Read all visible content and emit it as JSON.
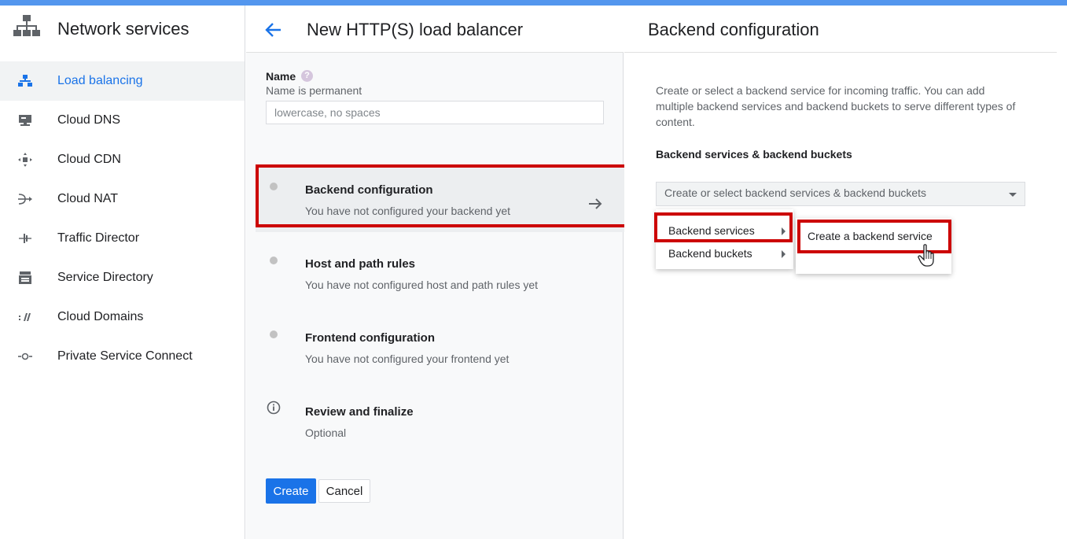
{
  "sidebar": {
    "title": "Network services",
    "items": [
      {
        "label": "Load balancing",
        "icon": "load-balancing-icon",
        "active": true
      },
      {
        "label": "Cloud DNS",
        "icon": "dns-icon"
      },
      {
        "label": "Cloud CDN",
        "icon": "cdn-icon"
      },
      {
        "label": "Cloud NAT",
        "icon": "nat-icon"
      },
      {
        "label": "Traffic Director",
        "icon": "traffic-director-icon"
      },
      {
        "label": "Service Directory",
        "icon": "service-directory-icon"
      },
      {
        "label": "Cloud Domains",
        "icon": "domains-icon"
      },
      {
        "label": "Private Service Connect",
        "icon": "private-service-connect-icon"
      }
    ]
  },
  "middle": {
    "title": "New HTTP(S) load balancer",
    "name_label": "Name",
    "name_hint": "Name is permanent",
    "name_placeholder": "lowercase, no spaces",
    "steps": [
      {
        "title": "Backend configuration",
        "subtitle": "You have not configured your backend yet"
      },
      {
        "title": "Host and path rules",
        "subtitle": "You have not configured host and path rules yet"
      },
      {
        "title": "Frontend configuration",
        "subtitle": "You have not configured your frontend yet"
      },
      {
        "title": "Review and finalize",
        "subtitle": "Optional"
      }
    ],
    "create_label": "Create",
    "cancel_label": "Cancel"
  },
  "right": {
    "title": "Backend configuration",
    "description": "Create or select a backend service for incoming traffic. You can add multiple backend services and backend buckets to serve different types of content.",
    "subheading": "Backend services & backend buckets",
    "select_placeholder": "Create or select backend services & backend buckets",
    "menu": [
      {
        "label": "Backend services"
      },
      {
        "label": "Backend buckets"
      }
    ],
    "submenu": [
      {
        "label": "Create a backend service"
      }
    ]
  },
  "colors": {
    "accent": "#1a73e8",
    "highlight": "#cc0000"
  }
}
